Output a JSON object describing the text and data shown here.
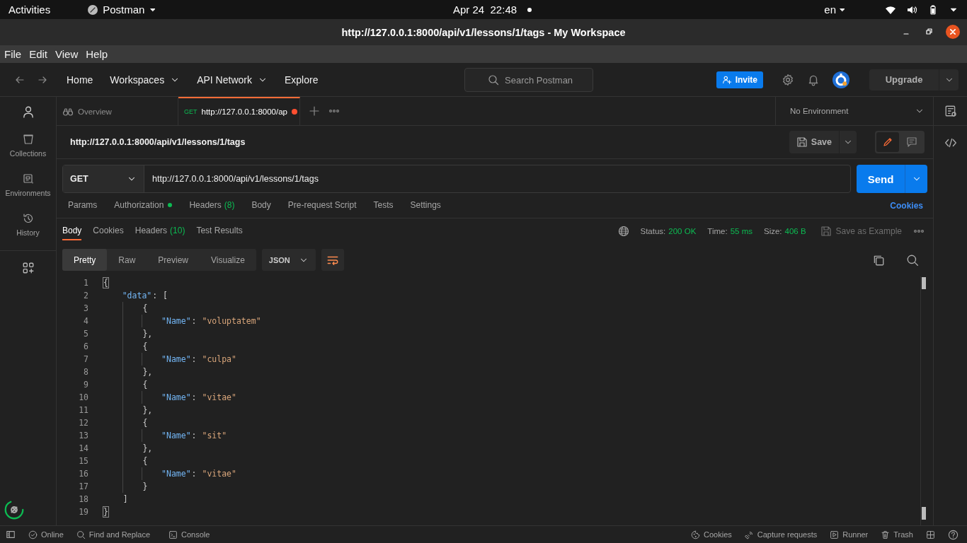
{
  "system_bar": {
    "activities": "Activities",
    "app": "Postman",
    "clock": "Apr 24  22:48",
    "language": "en"
  },
  "window": {
    "title": "http://127.0.0.1:8000/api/v1/lessons/1/tags - My Workspace"
  },
  "menu": [
    "File",
    "Edit",
    "View",
    "Help"
  ],
  "header": {
    "nav": [
      {
        "label": "Home",
        "dropdown": false
      },
      {
        "label": "Workspaces",
        "dropdown": true
      },
      {
        "label": "API Network",
        "dropdown": true
      },
      {
        "label": "Explore",
        "dropdown": false
      }
    ],
    "search": {
      "placeholder": "Search Postman"
    },
    "invite": "Invite",
    "upgrade": "Upgrade"
  },
  "sidebar": {
    "items": [
      {
        "label": "Collections"
      },
      {
        "label": "Environments"
      },
      {
        "label": "History"
      }
    ]
  },
  "tabs": [
    {
      "kind": "overview",
      "label": "Overview",
      "selected": false,
      "unsaved": false
    },
    {
      "kind": "request",
      "method": "GET",
      "label": "http://127.0.0.1:8000/ap",
      "selected": true,
      "unsaved": true
    }
  ],
  "environment": "No Environment",
  "request": {
    "title": "http://127.0.0.1:8000/api/v1/lessons/1/tags",
    "save": "Save",
    "method": "GET",
    "url": "http://127.0.0.1:8000/api/v1/lessons/1/tags",
    "send": "Send",
    "tabs": [
      {
        "label": "Params",
        "selected": false,
        "dot": false
      },
      {
        "label": "Authorization",
        "selected": false,
        "dot": true
      },
      {
        "label": "Headers",
        "count": "(8)",
        "selected": false,
        "dot": false
      },
      {
        "label": "Body",
        "selected": false,
        "dot": false
      },
      {
        "label": "Pre-request Script",
        "selected": false,
        "dot": false
      },
      {
        "label": "Tests",
        "selected": false,
        "dot": false
      },
      {
        "label": "Settings",
        "selected": false,
        "dot": false
      }
    ],
    "cookies": "Cookies"
  },
  "response": {
    "tabs": [
      {
        "label": "Body",
        "selected": true
      },
      {
        "label": "Cookies",
        "selected": false
      },
      {
        "label": "Headers",
        "count": "(10)",
        "selected": false
      },
      {
        "label": "Test Results",
        "selected": false
      }
    ],
    "status_label": "Status:",
    "status": "200 OK",
    "time_label": "Time:",
    "time": "55 ms",
    "size_label": "Size:",
    "size": "406 B",
    "save_example": "Save as Example",
    "views": [
      {
        "label": "Pretty",
        "selected": true
      },
      {
        "label": "Raw",
        "selected": false
      },
      {
        "label": "Preview",
        "selected": false
      },
      {
        "label": "Visualize",
        "selected": false
      }
    ],
    "format": "JSON",
    "lines": [
      {
        "number": "1",
        "text": "{",
        "matched": true
      },
      {
        "number": "2",
        "text": "    \"data\": [",
        "matched": false
      },
      {
        "number": "3",
        "text": "        {",
        "matched": false
      },
      {
        "number": "4",
        "text": "            \"Name\": \"voluptatem\"",
        "matched": false
      },
      {
        "number": "5",
        "text": "        },",
        "matched": false
      },
      {
        "number": "6",
        "text": "        {",
        "matched": false
      },
      {
        "number": "7",
        "text": "            \"Name\": \"culpa\"",
        "matched": false
      },
      {
        "number": "8",
        "text": "        },",
        "matched": false
      },
      {
        "number": "9",
        "text": "        {",
        "matched": false
      },
      {
        "number": "10",
        "text": "            \"Name\": \"vitae\"",
        "matched": false
      },
      {
        "number": "11",
        "text": "        },",
        "matched": false
      },
      {
        "number": "12",
        "text": "        {",
        "matched": false
      },
      {
        "number": "13",
        "text": "            \"Name\": \"sit\"",
        "matched": false
      },
      {
        "number": "14",
        "text": "        },",
        "matched": false
      },
      {
        "number": "15",
        "text": "        {",
        "matched": false
      },
      {
        "number": "16",
        "text": "            \"Name\": \"vitae\"",
        "matched": false
      },
      {
        "number": "17",
        "text": "        }",
        "matched": false
      },
      {
        "number": "18",
        "text": "    ]",
        "matched": false
      },
      {
        "number": "19",
        "text": "}",
        "matched": true
      }
    ]
  },
  "status_bar": {
    "left": [
      "Online",
      "Find and Replace",
      "Console"
    ],
    "right": [
      "Cookies",
      "Capture requests",
      "Runner",
      "Trash"
    ]
  }
}
